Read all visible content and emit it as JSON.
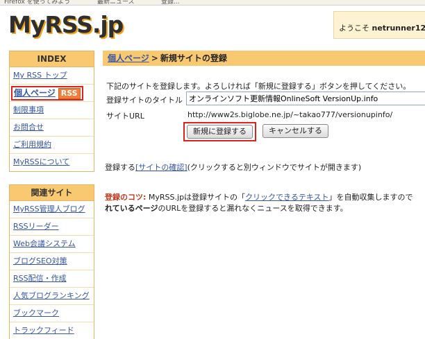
{
  "bookmarks_bar": {
    "items": [
      "Firefox を使ってみよう",
      "最新ニュース",
      "登録..."
    ]
  },
  "header": {
    "logo": "MyRSS.jp",
    "welcome_prefix": "ようこそ",
    "username": "netrunner12"
  },
  "sidebar": {
    "index_title": "INDEX",
    "index_items": [
      {
        "label": "My RSS トップ"
      },
      {
        "label": "個人ページ",
        "badge": "RSS"
      },
      {
        "label": "制限事項"
      },
      {
        "label": "お問合せ"
      },
      {
        "label": "ご利用規約"
      },
      {
        "label": "MyRSSについて"
      }
    ],
    "related_title": "関連サイト",
    "related_items": [
      {
        "label": "MyRSS管理人ブログ"
      },
      {
        "label": "RSSリーダー"
      },
      {
        "label": "Web会議システム"
      },
      {
        "label": "ブログSEO対策"
      },
      {
        "label": "RSS配信・作成"
      },
      {
        "label": "人気ブログランキング"
      },
      {
        "label": "ブックマーク"
      },
      {
        "label": "トラックフィード"
      }
    ]
  },
  "main": {
    "breadcrumb_link": "個人ページ",
    "breadcrumb_sep": ">",
    "breadcrumb_current": "新規サイトの登録",
    "intro": "下記のサイトを登録します。よろしければ「新規に登録する」ボタンを押してください。",
    "title_label": "登録サイトのタイトル",
    "title_value": "オンラインソフト更新情報OnlineSoft VersionUp.info",
    "url_label": "サイトURL",
    "url_value": "http://www2s.biglobe.ne.jp/~takao777/versionupinfo/",
    "register_button": "新規に登録する",
    "cancel_button": "キャンセルする",
    "confirm_prefix": "登録する",
    "confirm_link": "[サイトの確認]",
    "confirm_suffix": "(クリックすると別ウィンドウでサイトが開きます)",
    "tip_label": "登録のコツ:",
    "tip_text1": "MyRSS.jpは登録サイトの「",
    "tip_link": "クリックできるテキスト",
    "tip_text2": "」を自動収集しますので",
    "tip_bold": "れているページ",
    "tip_text3": "のURLを登録すると漏れなくニュースを取得できます。"
  }
}
